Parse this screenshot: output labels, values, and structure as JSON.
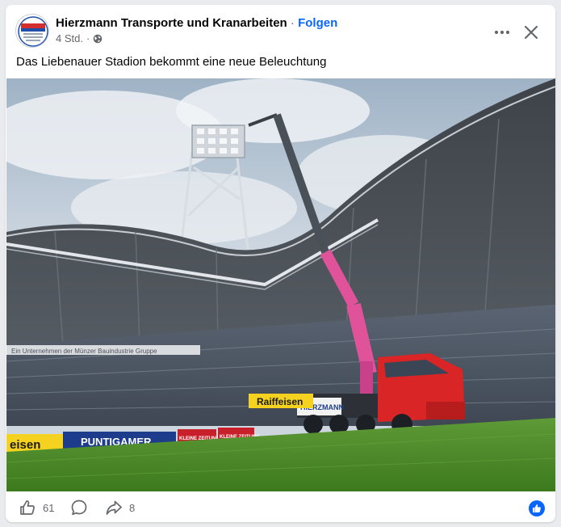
{
  "post": {
    "page_name": "Hierzmann Transporte und Kranarbeiten",
    "separator": "·",
    "follow_label": "Folgen",
    "timestamp": "4 Std.",
    "timestamp_sep": "·",
    "audience_icon": "globe-icon",
    "caption": "Das Liebenauer Stadion bekommt eine neue Beleuchtung",
    "avatar_text": "HIERZMANN",
    "photo": {
      "truck_label": "HIERZMANN",
      "ad_boards": [
        "eisen",
        "PUNTIGAMER",
        "KLEINE ZEITUNG",
        "KLEINE ZEITUNG",
        "Raiffeisen"
      ],
      "stand_banner": "Ein Unternehmen der Münzer Bauindustrie Gruppe"
    }
  },
  "footer": {
    "like_count": "61",
    "share_count": "8",
    "like_icon": "thumbs-up-icon",
    "comment_icon": "comment-icon",
    "share_icon": "share-icon",
    "reaction_icon": "like-reaction-icon"
  },
  "colors": {
    "accent": "#0866ff",
    "crane_pink": "#e0529a",
    "truck_red": "#d92525",
    "grass": "#4f8d2a"
  }
}
